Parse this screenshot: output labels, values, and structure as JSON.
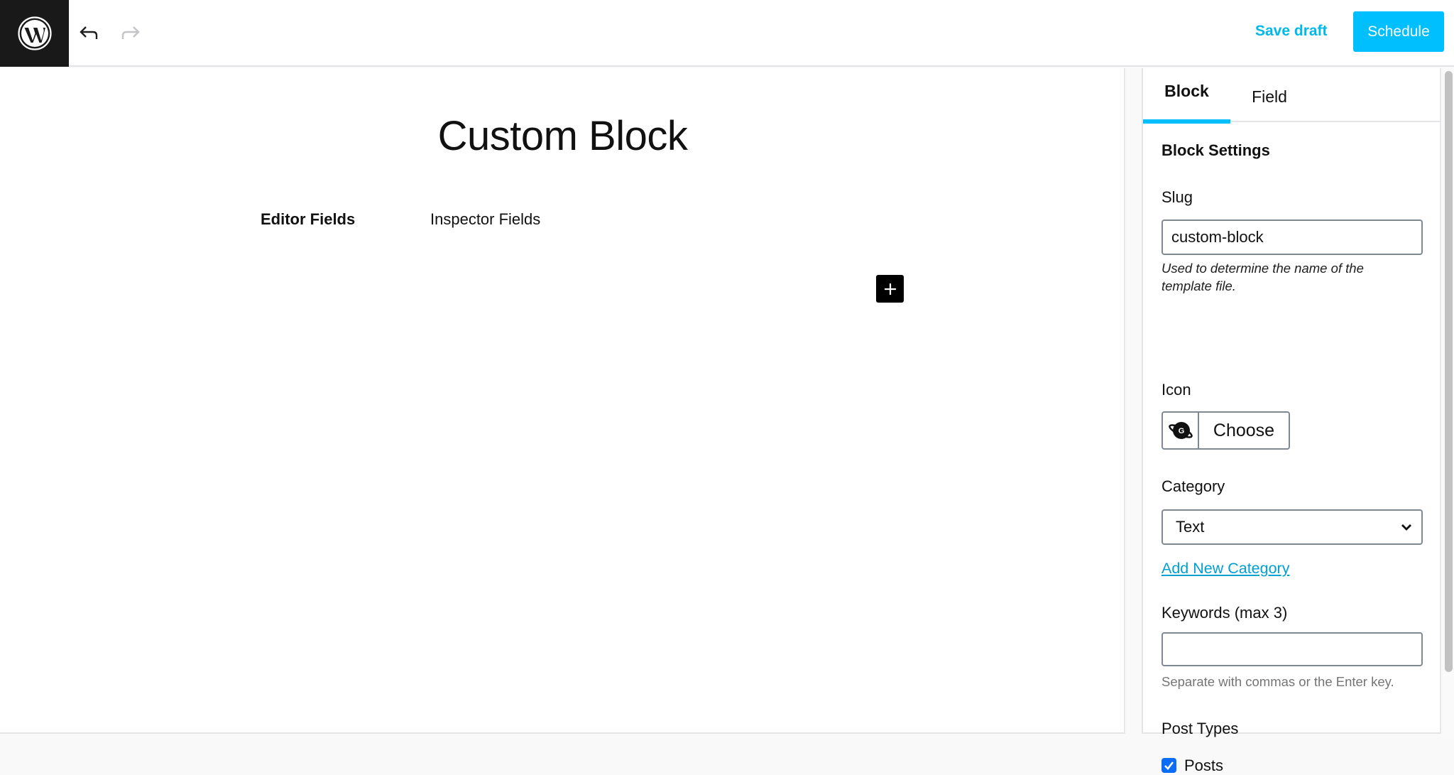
{
  "header": {
    "logo_icon": "wordpress-logo-icon",
    "undo_icon": "undo-icon",
    "redo_icon": "redo-icon",
    "save_draft_label": "Save draft",
    "schedule_label": "Schedule"
  },
  "editor": {
    "title": "Custom Block",
    "tabs": [
      {
        "label": "Editor Fields",
        "active": true
      },
      {
        "label": "Inspector Fields",
        "active": false
      }
    ],
    "add_block_icon": "plus-icon"
  },
  "sidebar": {
    "tabs": [
      {
        "label": "Block",
        "active": true
      },
      {
        "label": "Field",
        "active": false
      }
    ],
    "heading": "Block Settings",
    "slug": {
      "label": "Slug",
      "value": "custom-block",
      "help": "Used to determine the name of the template file."
    },
    "icon": {
      "label": "Icon",
      "preview_icon": "genesis-planet-icon",
      "choose_label": "Choose"
    },
    "category": {
      "label": "Category",
      "selected": "Text",
      "add_new_label": "Add New Category"
    },
    "keywords": {
      "label": "Keywords (max 3)",
      "value": "",
      "help": "Separate with commas or the Enter key."
    },
    "post_types": {
      "label": "Post Types",
      "options": [
        {
          "label": "Posts",
          "checked": true
        }
      ]
    }
  },
  "colors": {
    "accent": "#00bfff",
    "link": "#00a0d2",
    "logo_bg": "#191919",
    "checkbox": "#0b6cf7"
  }
}
